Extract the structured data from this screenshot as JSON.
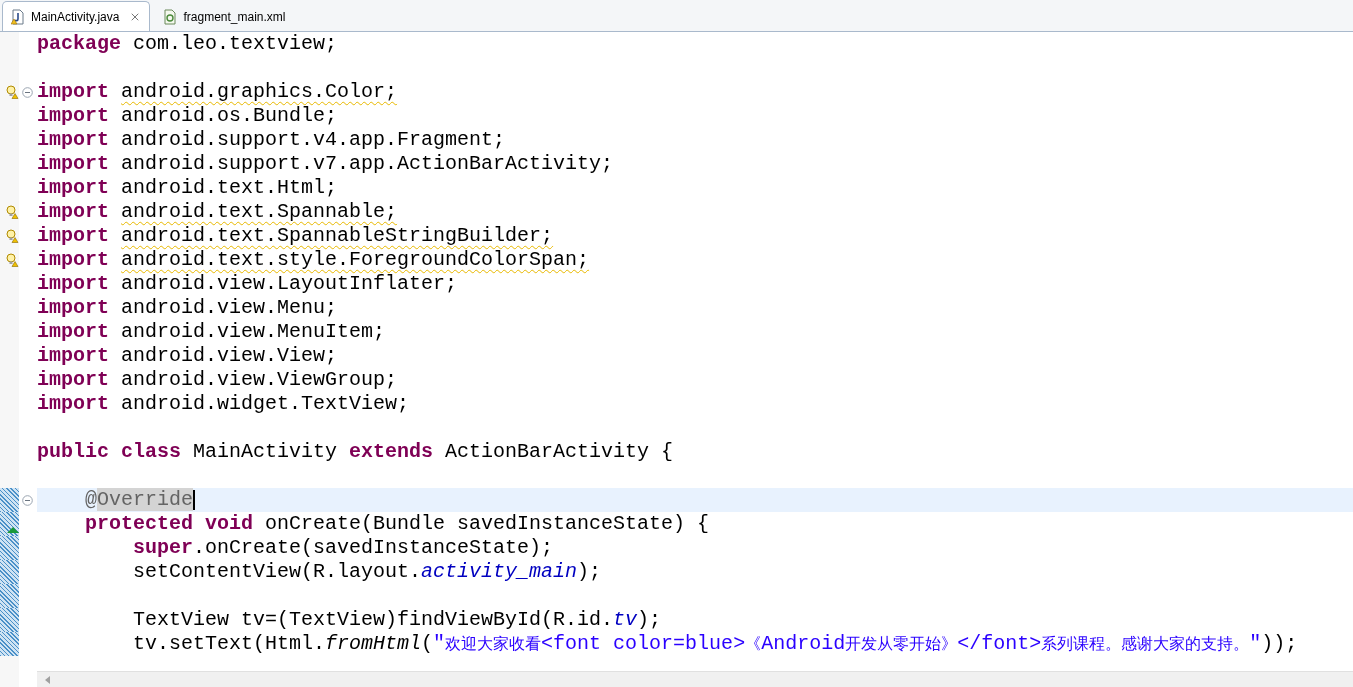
{
  "tabs": [
    {
      "label": "MainActivity.java",
      "kind": "java",
      "selected": true,
      "closable": true
    },
    {
      "label": "fragment_main.xml",
      "kind": "xml",
      "selected": false,
      "closable": false
    }
  ],
  "blocks": [
    {
      "lines": [
        {
          "tokens": [
            {
              "text": "package",
              "kind": "keyword"
            },
            {
              "text": " com.leo.textview;",
              "kind": "plain"
            }
          ]
        }
      ]
    },
    {
      "lines": [
        {
          "warning": true,
          "fold": true,
          "tokens": [
            {
              "text": "import ",
              "kind": "keyword"
            },
            {
              "text": "android.graphics.Color;",
              "kind": "plain",
              "warning": true
            }
          ]
        },
        {
          "tokens": [
            {
              "text": "import",
              "kind": "keyword"
            },
            {
              "text": " android.os.Bundle;",
              "kind": "plain"
            }
          ]
        },
        {
          "tokens": [
            {
              "text": "import",
              "kind": "keyword"
            },
            {
              "text": " android.support.v4.app.Fragment;",
              "kind": "plain"
            }
          ]
        },
        {
          "tokens": [
            {
              "text": "import",
              "kind": "keyword"
            },
            {
              "text": " android.support.v7.app.ActionBarActivity;",
              "kind": "plain"
            }
          ]
        },
        {
          "tokens": [
            {
              "text": "import",
              "kind": "keyword"
            },
            {
              "text": " android.text.Html;",
              "kind": "plain"
            }
          ]
        },
        {
          "warning": true,
          "tokens": [
            {
              "text": "import ",
              "kind": "keyword"
            },
            {
              "text": "android.text.Spannable;",
              "kind": "plain",
              "warning": true
            }
          ]
        },
        {
          "warning": true,
          "tokens": [
            {
              "text": "import ",
              "kind": "keyword"
            },
            {
              "text": "android.text.SpannableStringBuilder;",
              "kind": "plain",
              "warning": true
            }
          ]
        },
        {
          "warning": true,
          "tokens": [
            {
              "text": "import ",
              "kind": "keyword"
            },
            {
              "text": "android.text.style.ForegroundColorSpan;",
              "kind": "plain",
              "warning": true
            }
          ]
        },
        {
          "tokens": [
            {
              "text": "import",
              "kind": "keyword"
            },
            {
              "text": " android.view.LayoutInflater;",
              "kind": "plain"
            }
          ]
        },
        {
          "tokens": [
            {
              "text": "import",
              "kind": "keyword"
            },
            {
              "text": " android.view.Menu;",
              "kind": "plain"
            }
          ]
        },
        {
          "tokens": [
            {
              "text": "import",
              "kind": "keyword"
            },
            {
              "text": " android.view.MenuItem;",
              "kind": "plain"
            }
          ]
        },
        {
          "tokens": [
            {
              "text": "import",
              "kind": "keyword"
            },
            {
              "text": " android.view.View;",
              "kind": "plain"
            }
          ]
        },
        {
          "tokens": [
            {
              "text": "import",
              "kind": "keyword"
            },
            {
              "text": " android.view.ViewGroup;",
              "kind": "plain"
            }
          ]
        },
        {
          "tokens": [
            {
              "text": "import",
              "kind": "keyword"
            },
            {
              "text": " android.widget.TextView;",
              "kind": "plain"
            }
          ]
        }
      ]
    },
    {
      "lines": [
        {
          "tokens": [
            {
              "text": "public class",
              "kind": "keyword"
            },
            {
              "text": " MainActivity ",
              "kind": "plain"
            },
            {
              "text": "extends",
              "kind": "keyword"
            },
            {
              "text": " ActionBarActivity {",
              "kind": "plain"
            }
          ]
        }
      ]
    },
    {
      "lines": [
        {
          "current": true,
          "fold": true,
          "changed": true,
          "tokens": [
            {
              "text": "    @",
              "kind": "annotation"
            },
            {
              "text": "Override",
              "kind": "annotation",
              "selected": true
            }
          ]
        },
        {
          "changed": true,
          "diff_arrow": true,
          "tokens": [
            {
              "text": "    protected void",
              "kind": "keyword"
            },
            {
              "text": " onCreate(Bundle savedInstanceState) {",
              "kind": "plain"
            }
          ]
        },
        {
          "changed": true,
          "tokens": [
            {
              "text": "        super",
              "kind": "keyword"
            },
            {
              "text": ".onCreate(savedInstanceState);",
              "kind": "plain"
            }
          ]
        },
        {
          "changed": true,
          "tokens": [
            {
              "text": "        setContentView(R.layout.",
              "kind": "plain"
            },
            {
              "text": "activity_main",
              "kind": "static_field"
            },
            {
              "text": ");",
              "kind": "plain"
            }
          ]
        },
        {
          "changed": true
        },
        {
          "changed": true,
          "tokens": [
            {
              "text": "        TextView tv=(TextView)findViewById(R.id.",
              "kind": "plain"
            },
            {
              "text": "tv",
              "kind": "static_field"
            },
            {
              "text": ");",
              "kind": "plain"
            }
          ]
        },
        {
          "changed": true,
          "tokens": [
            {
              "text": "        tv.setText(Html.",
              "kind": "plain"
            },
            {
              "text": "fromHtml",
              "kind": "static_method"
            },
            {
              "text": "(",
              "kind": "plain"
            },
            {
              "text": "\"欢迎大家收看<font color=blue>《Android开发从零开始》</font>系列课程。感谢大家的支持。\"",
              "kind": "string"
            },
            {
              "text": "));",
              "kind": "plain"
            }
          ]
        }
      ]
    }
  ]
}
